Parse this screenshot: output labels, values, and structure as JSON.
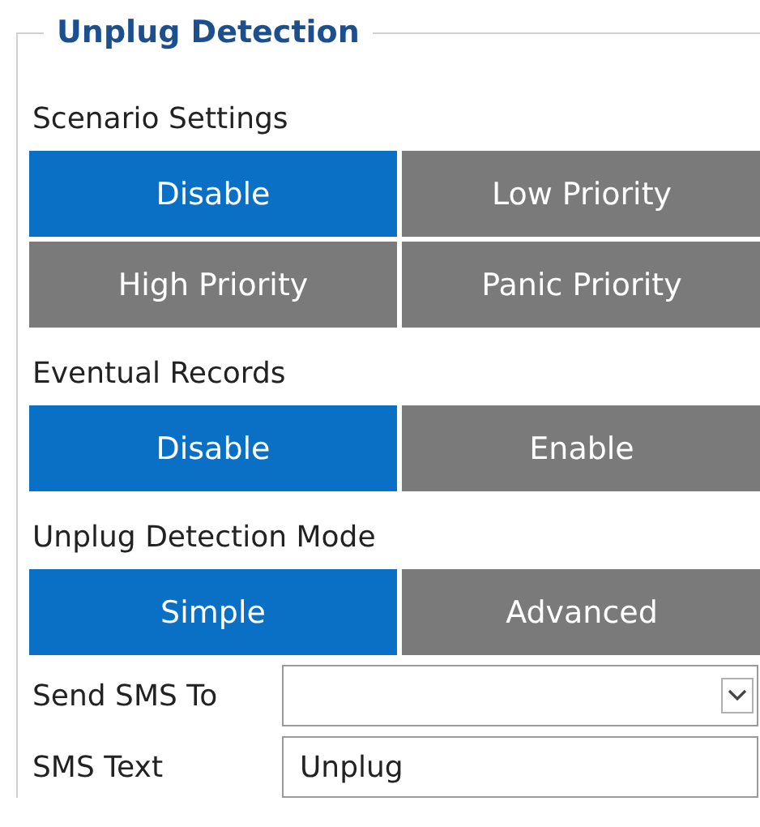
{
  "group": {
    "title": "Unplug Detection"
  },
  "sections": [
    {
      "label": "Scenario Settings",
      "options": [
        {
          "label": "Disable",
          "selected": true
        },
        {
          "label": "Low Priority",
          "selected": false
        },
        {
          "label": "High Priority",
          "selected": false
        },
        {
          "label": "Panic Priority",
          "selected": false
        }
      ]
    },
    {
      "label": "Eventual Records",
      "options": [
        {
          "label": "Disable",
          "selected": true
        },
        {
          "label": "Enable",
          "selected": false
        }
      ]
    },
    {
      "label": "Unplug Detection Mode",
      "options": [
        {
          "label": "Simple",
          "selected": true
        },
        {
          "label": "Advanced",
          "selected": false
        }
      ]
    }
  ],
  "fields": [
    {
      "kind": "select",
      "label": "Send SMS To"
    },
    {
      "kind": "text",
      "label": "SMS Text",
      "value": "Unplug"
    }
  ]
}
